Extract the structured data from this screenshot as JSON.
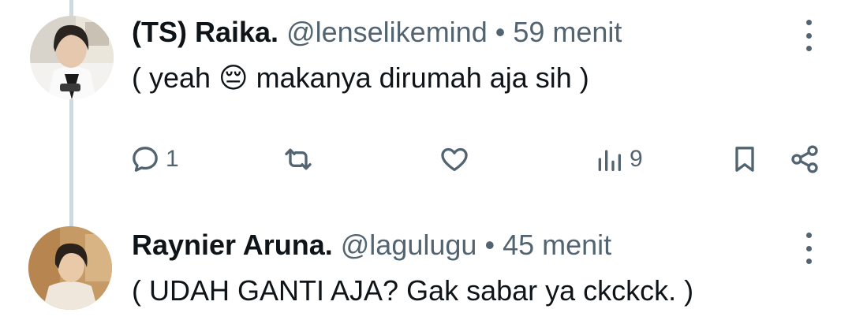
{
  "tweets": [
    {
      "name": "(TS) Raika.",
      "handle": "@lenselikemind",
      "separator": "•",
      "time": "59 menit",
      "text": "( yeah 😔 makanya dirumah aja sih )",
      "reply_count": "1",
      "views_count": "9"
    },
    {
      "name": "Raynier Aruna.",
      "handle": "@lagulugu",
      "separator": "•",
      "time": "45 menit",
      "text": "( UDAH GANTI AJA? Gak sabar ya ckckck. )"
    }
  ],
  "icons": {
    "reply": "reply-icon",
    "retweet": "retweet-icon",
    "like": "heart-icon",
    "views": "views-icon",
    "bookmark": "bookmark-icon",
    "share": "share-icon",
    "more": "more-vertical-icon"
  },
  "colors": {
    "text_primary": "#0f1419",
    "text_secondary": "#536471",
    "thread_line": "#cfd9de"
  }
}
